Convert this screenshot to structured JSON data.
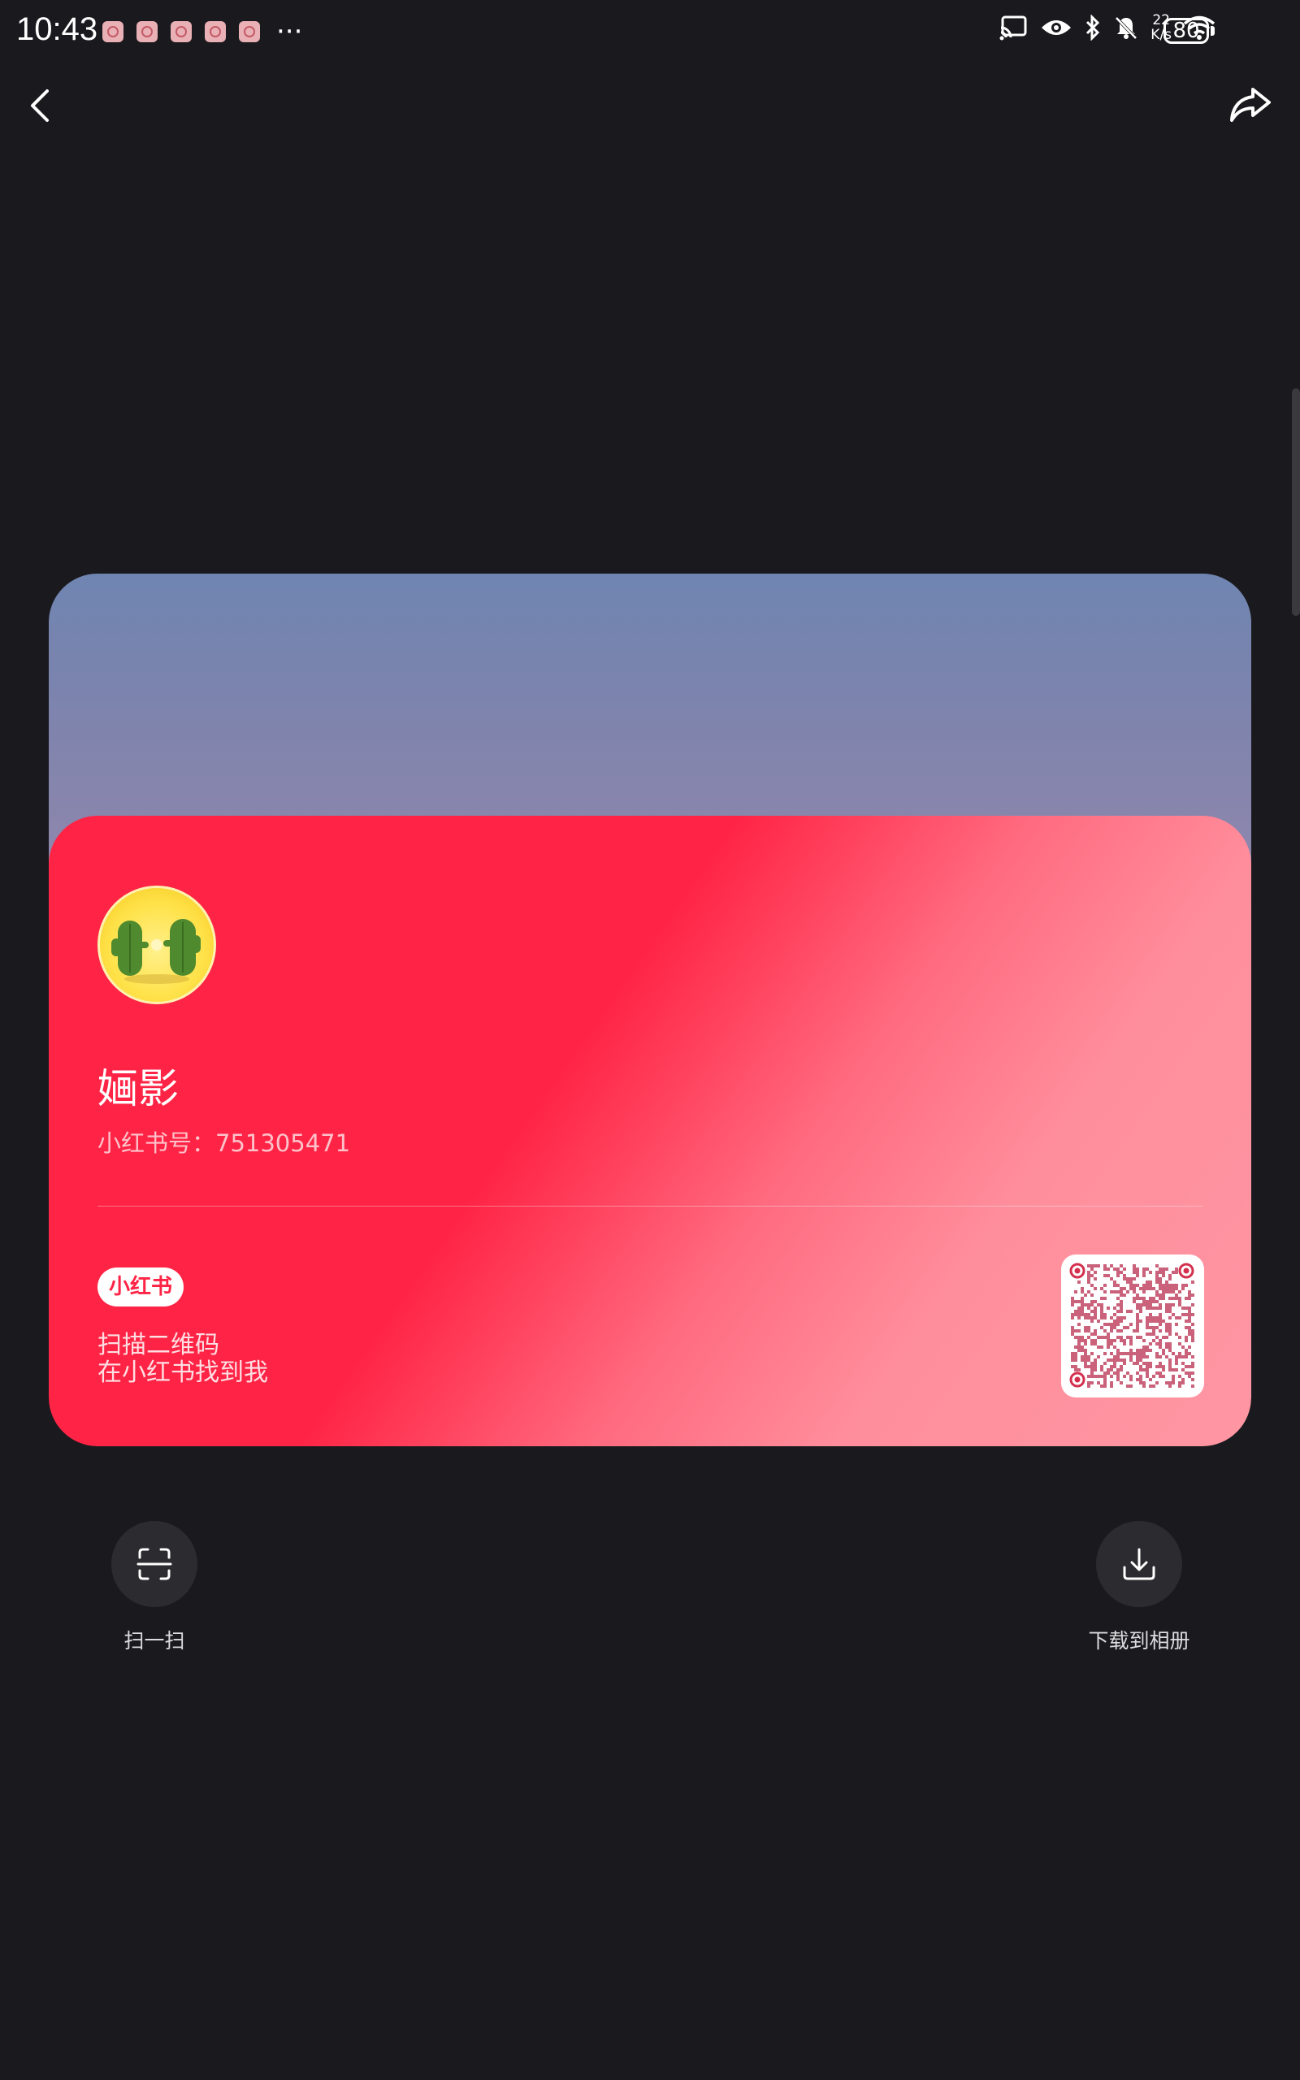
{
  "status_bar": {
    "time": "10:43",
    "more_indicator": "···",
    "net_speed_value": "22",
    "net_speed_unit": "K/s",
    "battery_level": "80"
  },
  "card": {
    "username": "婳影",
    "user_id_label": "小红书号：751305471",
    "brand_logo_text": "小红书",
    "scan_hint_line1": "扫描二维码",
    "scan_hint_line2": "在小红书找到我",
    "colors": {
      "primary": "#ff2445",
      "cover_top": "#6f85b1"
    }
  },
  "actions": {
    "scan_label": "扫一扫",
    "download_label": "下载到相册"
  },
  "icons": {
    "back": "chevron-left-icon",
    "share": "share-icon",
    "scan": "scan-icon",
    "download": "download-icon"
  }
}
